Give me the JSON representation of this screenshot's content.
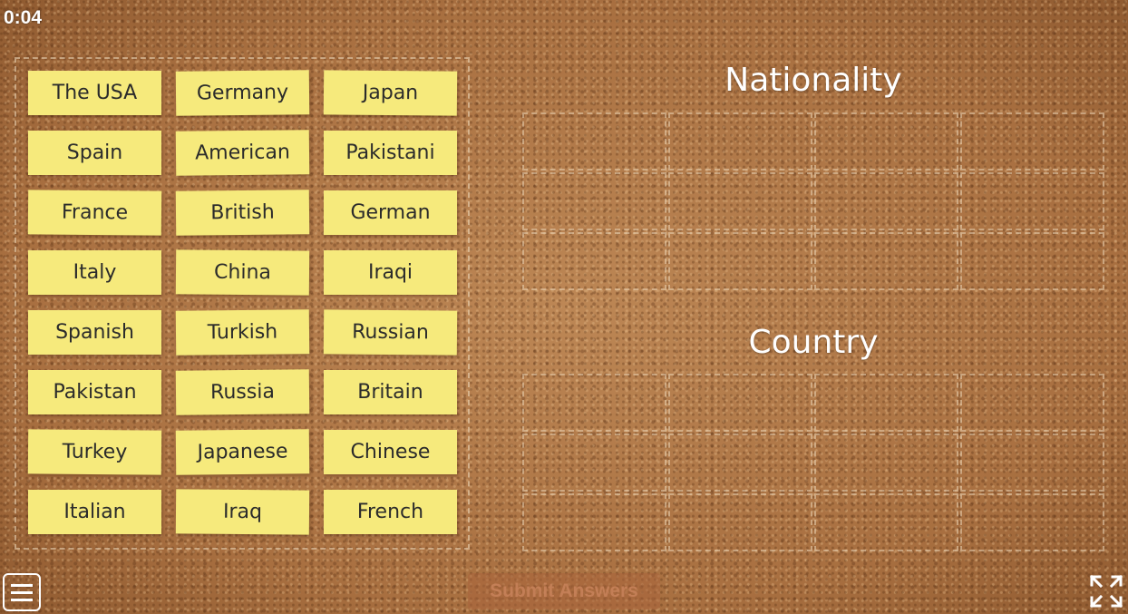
{
  "timer": "0:04",
  "cards": [
    "The USA",
    "Germany",
    "Japan",
    "Spain",
    "American",
    "Pakistani",
    "France",
    "British",
    "German",
    "Italy",
    "China",
    "Iraqi",
    "Spanish",
    "Turkish",
    "Russian",
    "Pakistan",
    "Russia",
    "Britain",
    "Turkey",
    "Japanese",
    "Chinese",
    "Italian",
    "Iraq",
    "French"
  ],
  "groups": {
    "nationality": "Nationality",
    "country": "Country"
  },
  "submit_label": "Submit Answers",
  "icons": {
    "menu": "hamburger-menu-icon",
    "fullscreen": "fullscreen-icon"
  },
  "colors": {
    "card": "#f6ea7c",
    "board": "#b27b4b",
    "text": "#ffffff"
  }
}
